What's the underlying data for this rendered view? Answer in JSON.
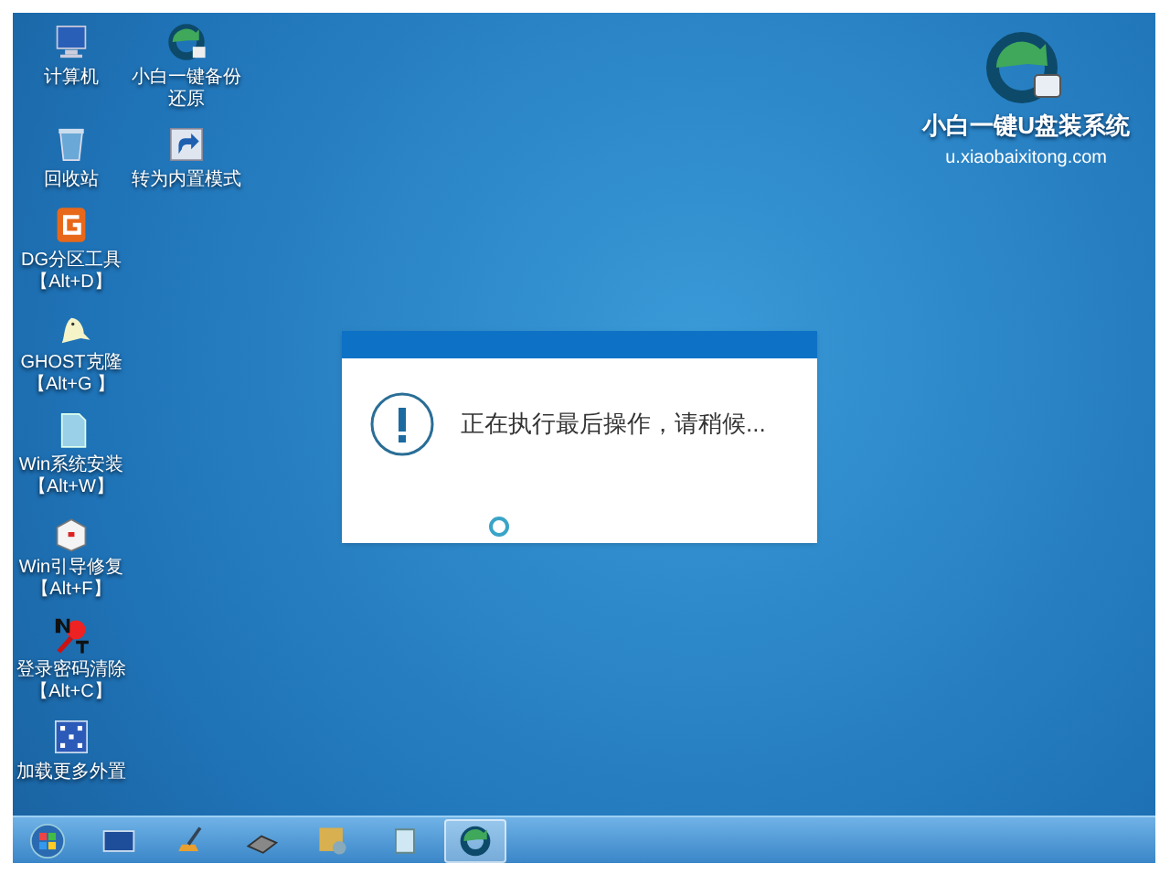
{
  "desktop_icon_rows": [
    [
      {
        "kind": "computer",
        "label": [
          "计算机"
        ]
      },
      {
        "kind": "backup",
        "label": [
          "小白一键备份",
          "还原"
        ]
      }
    ],
    [
      {
        "kind": "recycle",
        "label": [
          "回收站"
        ]
      },
      {
        "kind": "shortcut",
        "label": [
          "转为内置模式"
        ]
      }
    ],
    [
      {
        "kind": "partition",
        "label": [
          "DG分区工具",
          "【Alt+D】"
        ]
      }
    ],
    [
      {
        "kind": "ghost",
        "label": [
          "GHOST克隆",
          "【Alt+G 】"
        ]
      }
    ],
    [
      {
        "kind": "installer",
        "label": [
          "Win系统安装",
          "【Alt+W】"
        ]
      }
    ],
    [
      {
        "kind": "repair",
        "label": [
          "Win引导修复",
          "【Alt+F】"
        ]
      }
    ],
    [
      {
        "kind": "password",
        "label": [
          "登录密码清除",
          "【Alt+C】"
        ]
      }
    ],
    [
      {
        "kind": "network",
        "label": [
          "加载更多外置"
        ]
      }
    ]
  ],
  "logo": {
    "title": "小白一键U盘装系统",
    "url": "u.xiaobaixitong.com"
  },
  "dialog": {
    "message": "正在执行最后操作，请稍候..."
  },
  "taskbar": [
    {
      "kind": "start",
      "selected": false
    },
    {
      "kind": "screen",
      "selected": false
    },
    {
      "kind": "brush",
      "selected": false
    },
    {
      "kind": "disk",
      "selected": false
    },
    {
      "kind": "tools",
      "selected": false
    },
    {
      "kind": "notepad",
      "selected": false
    },
    {
      "kind": "backup",
      "selected": true
    }
  ]
}
